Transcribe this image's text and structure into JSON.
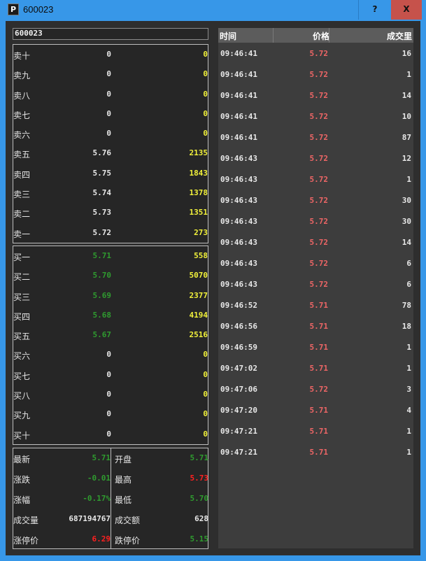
{
  "window": {
    "icon_letter": "P",
    "title": "600023",
    "help_label": "?",
    "close_label": "X"
  },
  "colors": {
    "titlebar": "#3797e8",
    "close_button": "#c6524b",
    "panel_bg": "#262626",
    "price_up": "#ee6666",
    "price_down": "#2f9b2f",
    "volume": "#f2f23b",
    "limit_up": "#ff2020"
  },
  "stock_code": "600023",
  "asks": [
    {
      "label": "卖十",
      "price": "0",
      "volume": "0"
    },
    {
      "label": "卖九",
      "price": "0",
      "volume": "0"
    },
    {
      "label": "卖八",
      "price": "0",
      "volume": "0"
    },
    {
      "label": "卖七",
      "price": "0",
      "volume": "0"
    },
    {
      "label": "卖六",
      "price": "0",
      "volume": "0"
    },
    {
      "label": "卖五",
      "price": "5.76",
      "volume": "2135"
    },
    {
      "label": "卖四",
      "price": "5.75",
      "volume": "1843"
    },
    {
      "label": "卖三",
      "price": "5.74",
      "volume": "1378"
    },
    {
      "label": "卖二",
      "price": "5.73",
      "volume": "1351"
    },
    {
      "label": "卖一",
      "price": "5.72",
      "volume": "273"
    }
  ],
  "bids": [
    {
      "label": "买一",
      "price": "5.71",
      "volume": "558"
    },
    {
      "label": "买二",
      "price": "5.70",
      "volume": "5070"
    },
    {
      "label": "买三",
      "price": "5.69",
      "volume": "2377"
    },
    {
      "label": "买四",
      "price": "5.68",
      "volume": "4194"
    },
    {
      "label": "买五",
      "price": "5.67",
      "volume": "2516"
    },
    {
      "label": "买六",
      "price": "0",
      "volume": "0"
    },
    {
      "label": "买七",
      "price": "0",
      "volume": "0"
    },
    {
      "label": "买八",
      "price": "0",
      "volume": "0"
    },
    {
      "label": "买九",
      "price": "0",
      "volume": "0"
    },
    {
      "label": "买十",
      "price": "0",
      "volume": "0"
    }
  ],
  "stats": {
    "left": [
      {
        "label": "最新",
        "value": "5.71"
      },
      {
        "label": "涨跌",
        "value": "-0.01"
      },
      {
        "label": "涨幅",
        "value": "-0.17%"
      },
      {
        "label": "成交量",
        "value": "687194767"
      },
      {
        "label": "涨停价",
        "value": "6.29"
      }
    ],
    "right": [
      {
        "label": "开盘",
        "value": "5.71"
      },
      {
        "label": "最高",
        "value": "5.73"
      },
      {
        "label": "最低",
        "value": "5.70"
      },
      {
        "label": "成交额",
        "value": "628"
      },
      {
        "label": "跌停价",
        "value": "5.15"
      }
    ]
  },
  "trades_header": {
    "time": "时间",
    "price": "价格",
    "volume": "成交里"
  },
  "trades": [
    {
      "time": "09:46:41",
      "price": "5.72",
      "volume": "16"
    },
    {
      "time": "09:46:41",
      "price": "5.72",
      "volume": "1"
    },
    {
      "time": "09:46:41",
      "price": "5.72",
      "volume": "14"
    },
    {
      "time": "09:46:41",
      "price": "5.72",
      "volume": "10"
    },
    {
      "time": "09:46:41",
      "price": "5.72",
      "volume": "87"
    },
    {
      "time": "09:46:43",
      "price": "5.72",
      "volume": "12"
    },
    {
      "time": "09:46:43",
      "price": "5.72",
      "volume": "1"
    },
    {
      "time": "09:46:43",
      "price": "5.72",
      "volume": "30"
    },
    {
      "time": "09:46:43",
      "price": "5.72",
      "volume": "30"
    },
    {
      "time": "09:46:43",
      "price": "5.72",
      "volume": "14"
    },
    {
      "time": "09:46:43",
      "price": "5.72",
      "volume": "6"
    },
    {
      "time": "09:46:43",
      "price": "5.72",
      "volume": "6"
    },
    {
      "time": "09:46:52",
      "price": "5.71",
      "volume": "78"
    },
    {
      "time": "09:46:56",
      "price": "5.71",
      "volume": "18"
    },
    {
      "time": "09:46:59",
      "price": "5.71",
      "volume": "1"
    },
    {
      "time": "09:47:02",
      "price": "5.71",
      "volume": "1"
    },
    {
      "time": "09:47:06",
      "price": "5.72",
      "volume": "3"
    },
    {
      "time": "09:47:20",
      "price": "5.71",
      "volume": "4"
    },
    {
      "time": "09:47:21",
      "price": "5.71",
      "volume": "1"
    },
    {
      "time": "09:47:21",
      "price": "5.71",
      "volume": "1"
    }
  ]
}
